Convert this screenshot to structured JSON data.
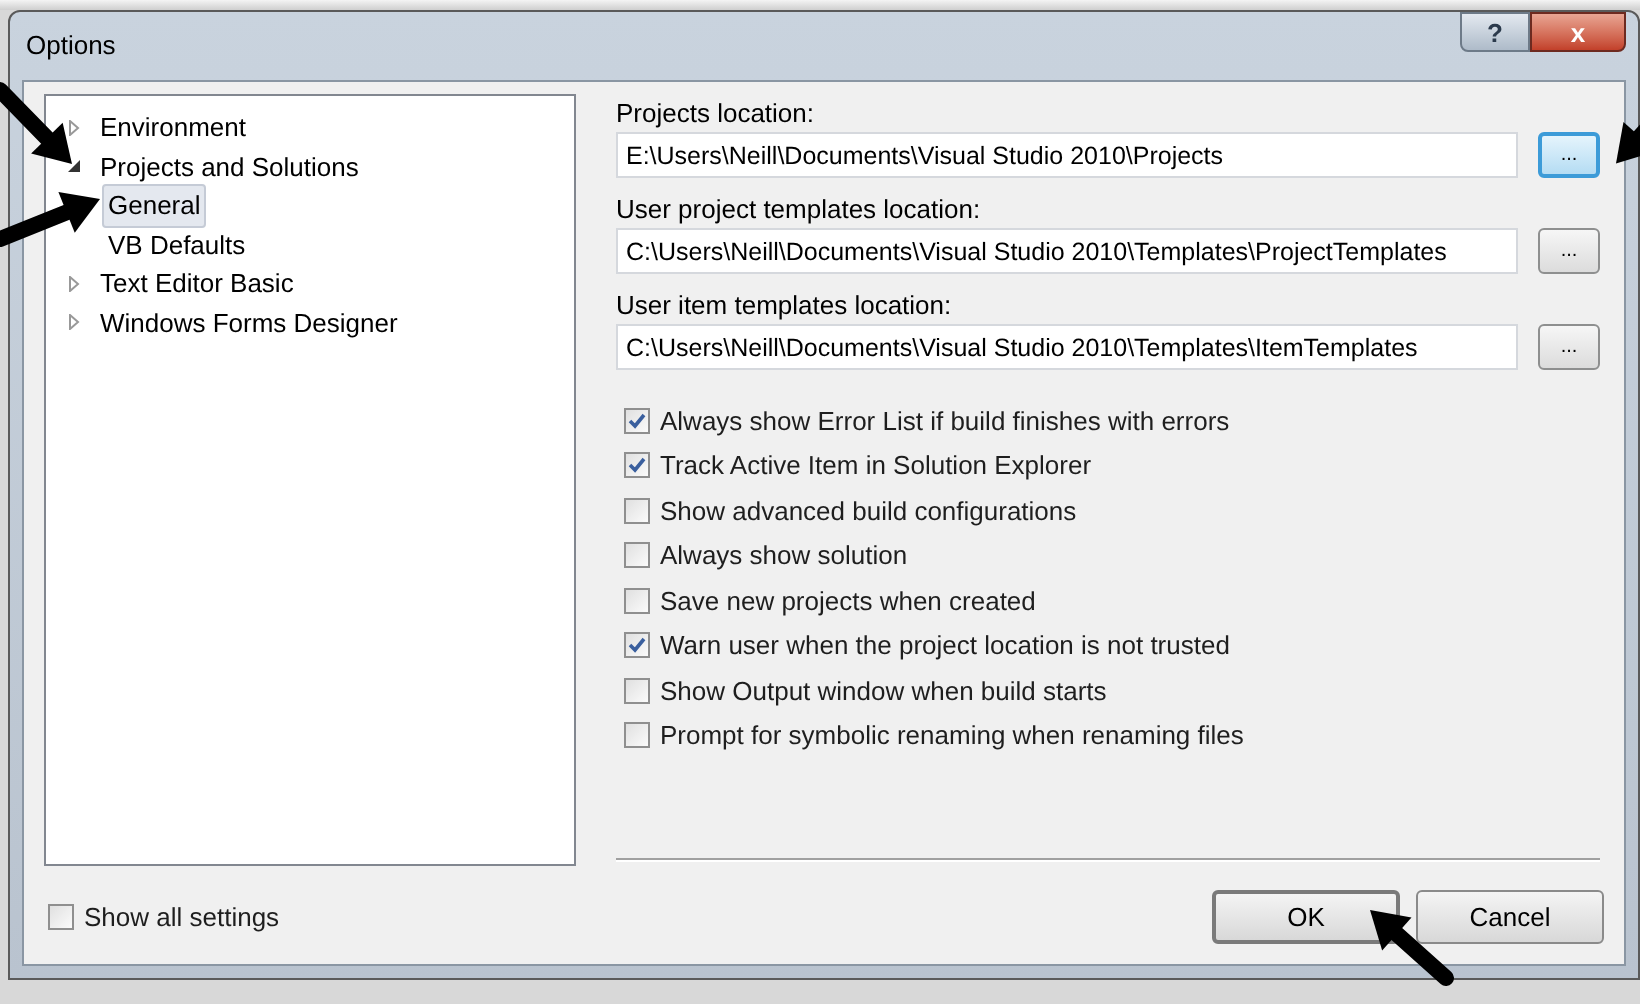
{
  "window": {
    "title": "Options",
    "buttons": [
      {
        "kind": "help",
        "label": "?"
      },
      {
        "kind": "close",
        "label": "x"
      }
    ]
  },
  "tree": [
    {
      "label": "Environment",
      "expanded": false,
      "selected": false
    },
    {
      "label": "Projects and Solutions",
      "expanded": true,
      "selected": false,
      "children": [
        {
          "label": "General",
          "selected": true
        },
        {
          "label": "VB Defaults",
          "selected": false
        }
      ]
    },
    {
      "label": "Text Editor Basic",
      "expanded": false,
      "selected": false
    },
    {
      "label": "Windows Forms Designer",
      "expanded": false,
      "selected": false
    }
  ],
  "locations": [
    {
      "label": "Projects location:",
      "value": "E:\\Users\\Neill\\Documents\\Visual Studio 2010\\Projects",
      "browse": "...",
      "focused": true
    },
    {
      "label": "User project templates location:",
      "value": "C:\\Users\\Neill\\Documents\\Visual Studio 2010\\Templates\\ProjectTemplates",
      "browse": "...",
      "focused": false
    },
    {
      "label": "User item templates location:",
      "value": "C:\\Users\\Neill\\Documents\\Visual Studio 2010\\Templates\\ItemTemplates",
      "browse": "...",
      "focused": false
    }
  ],
  "options": [
    {
      "label": "Always show Error List if build finishes with errors",
      "checked": true
    },
    {
      "label": "Track Active Item in Solution Explorer",
      "checked": true
    },
    {
      "label": "Show advanced build configurations",
      "checked": false
    },
    {
      "label": "Always show solution",
      "checked": false
    },
    {
      "label": "Save new projects when created",
      "checked": false
    },
    {
      "label": "Warn user when the project location is not trusted",
      "checked": true
    },
    {
      "label": "Show Output window when build starts",
      "checked": false
    },
    {
      "label": "Prompt for symbolic renaming when renaming files",
      "checked": false
    }
  ],
  "show_all_settings": {
    "label": "Show all settings",
    "checked": false
  },
  "buttons": [
    {
      "label": "OK",
      "default": true
    },
    {
      "label": "Cancel",
      "default": false
    }
  ]
}
